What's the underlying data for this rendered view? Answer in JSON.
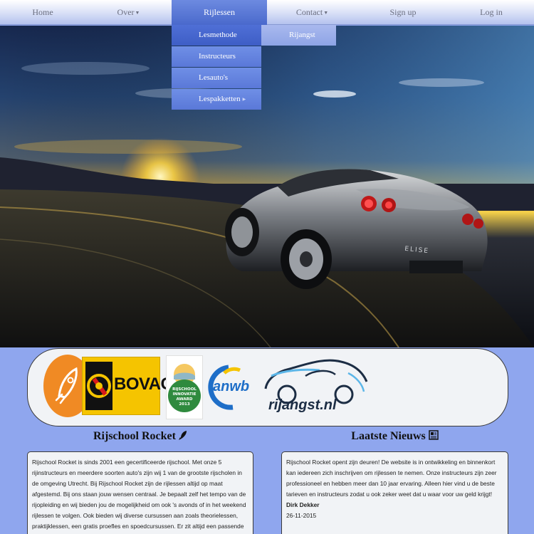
{
  "nav": {
    "items": [
      {
        "label": "Home"
      },
      {
        "label": "Over"
      },
      {
        "label": "Rijlessen"
      },
      {
        "label": "Contact"
      },
      {
        "label": "Sign up"
      },
      {
        "label": "Log in"
      }
    ],
    "active": "Rijlessen"
  },
  "dropdown": {
    "items": [
      {
        "label": "Lesmethode"
      },
      {
        "label": "Instructeurs"
      },
      {
        "label": "Lesauto's"
      },
      {
        "label": "Lespakketten"
      }
    ],
    "submenu": {
      "label": "Rijangst"
    }
  },
  "logos": {
    "bovag": "BOVAG",
    "anwb": "anwb",
    "rijangst": "rijangst.nl",
    "award_lines": [
      "RIJSCHOOL",
      "INNOVATIE",
      "AWARD",
      "2013"
    ]
  },
  "left_section": {
    "title": "Rijschool Rocket",
    "paragraph": "Rijschool Rocket is sinds 2001 een gecertificeerde rijschool. Met onze 5 rijinstructeurs en meerdere soorten auto's zijn wij 1 van de grootste rijscholen in de omgeving Utrecht. Bij Rijschool Rocket zijn de rijlessen altijd op maat afgestemd. Bij ons staan jouw wensen centraal. Je bepaalt zelf het tempo van de rijopleiding en wij bieden jou de mogelijkheid om ook 's avonds of in het weekend rijlessen te volgen. Ook bieden wij diverse cursussen aan zoals theorielessen, praktijklessen, een gratis proefles en spoedcursussen. Er zit altijd een passende cursus voor jou bij."
  },
  "right_section": {
    "title": "Laatste Nieuws",
    "paragraph": "Rijschool Rocket opent zijn deuren! De website is in ontwikkeling en binnenkort kan iedereen zich inschrijven om rijlessen te nemen. Onze instructeurs zijn zeer professioneel en hebben meer dan 10 jaar ervaring. Alleen hier vind u de beste tarieven en instructeurs zodat u ook zeker weet dat u waar voor uw geld krijgt!",
    "author": "Dirk Dekker",
    "date": "26-11-2015"
  },
  "colors": {
    "nav_active": "#4a69cc",
    "dropdown": "#5a78d8",
    "page_background": "#8fa6ee",
    "rocket_orange": "#f08a24",
    "bovag_yellow": "#f5c400",
    "anwb_blue": "#1e6ec8"
  }
}
